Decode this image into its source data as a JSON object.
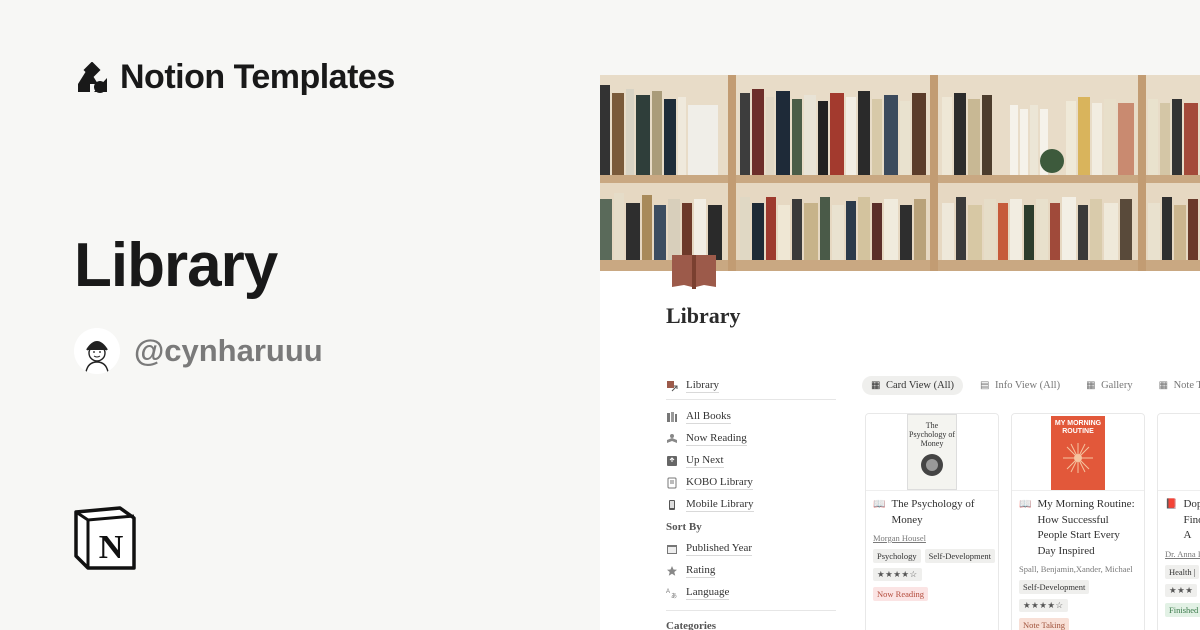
{
  "brand": {
    "text": "Notion Templates",
    "logo_icon": "notion-templates-shapes-icon"
  },
  "title": "Library",
  "author": {
    "handle": "@cynharuuu",
    "avatar_icon": "avatar-icon"
  },
  "notion_logo_icon": "notion-logo-icon",
  "colors": {
    "background": "#f7f7f5",
    "page_icon": "#9c5a4a",
    "now_reading": "#fbe4e4",
    "note_taking": "#f8e0d7",
    "finished": "#e2f1e5",
    "cover_orange": "#e2583a"
  },
  "panel": {
    "page_title": "Library",
    "sidebar": {
      "top_item": {
        "label": "Library",
        "icon": "library-link-icon"
      },
      "items": [
        {
          "label": "All Books",
          "icon": "books-icon"
        },
        {
          "label": "Now Reading",
          "icon": "reading-icon"
        },
        {
          "label": "Up Next",
          "icon": "next-icon"
        },
        {
          "label": "KOBO Library",
          "icon": "ereader-icon"
        },
        {
          "label": "Mobile Library",
          "icon": "phone-icon"
        }
      ],
      "sort_heading": "Sort By",
      "sort_items": [
        {
          "label": "Published Year",
          "icon": "calendar-icon"
        },
        {
          "label": "Rating",
          "icon": "star-icon"
        },
        {
          "label": "Language",
          "icon": "translate-icon"
        }
      ],
      "categories_heading": "Categories"
    },
    "tabs": [
      {
        "label": "Card View (All)",
        "active": true
      },
      {
        "label": "Info View (All)",
        "active": false
      },
      {
        "label": "Gallery",
        "active": false
      },
      {
        "label": "Note Taken",
        "active": false
      }
    ],
    "cards": [
      {
        "cover_title": "The Psychology of Money",
        "title": "The Psychology of Money",
        "author": "Morgan Housel",
        "tags": [
          "Psychology",
          "Self-Development"
        ],
        "stars": "★★★★☆",
        "status": "Now Reading"
      },
      {
        "cover_title": "MY MORNING ROUTINE",
        "title": "My Morning Routine: How Successful People Start Every Day Inspired",
        "author": "Spall, Benjamin,Xander, Michael",
        "tags": [
          "Self-Development"
        ],
        "stars": "★★★★☆",
        "status": "Note Taking"
      },
      {
        "cover_title": "",
        "title": "Dop Find the A",
        "author": "Dr. Anna L",
        "tags": [
          "Health |"
        ],
        "stars": "★★★",
        "status": "Finished"
      }
    ]
  }
}
